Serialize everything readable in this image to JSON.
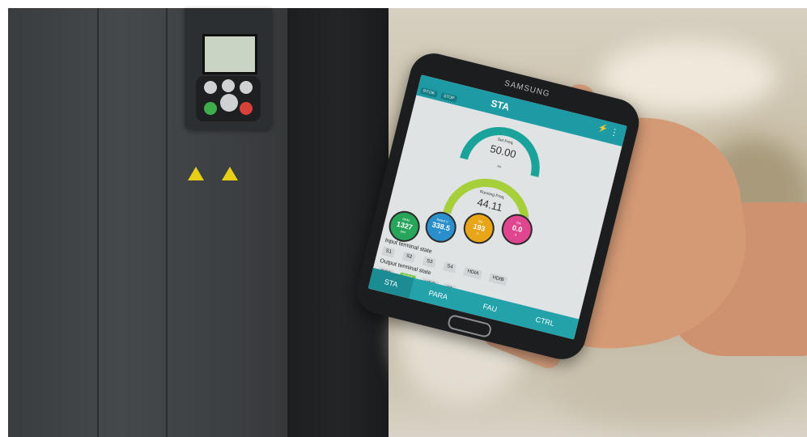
{
  "phone": {
    "brand": "SAMSUNG",
    "app_title": "STA",
    "status": [
      "RT:OK",
      "STOP"
    ],
    "gauges": [
      {
        "label": "Set Freq.",
        "value": "50.00",
        "unit": "Hz",
        "max": "50.00",
        "fill": 1.0,
        "color": "#1aa39b"
      },
      {
        "label": "Running Freq.",
        "value": "44.11",
        "unit": "Hz",
        "max": "50.00",
        "fill": 0.88,
        "color": "#a6cf3a"
      }
    ],
    "bubbles": [
      {
        "label": "RPM",
        "value": "1327",
        "unit": "rpm",
        "color": "#27a55b"
      },
      {
        "label": "Rated V",
        "value": "338.5",
        "unit": "V",
        "color": "#2a8fcb"
      },
      {
        "label": "OV",
        "value": "193",
        "unit": "V",
        "color": "#e7a517"
      },
      {
        "label": "OA",
        "value": "0.0",
        "unit": "A",
        "color": "#e0458f"
      }
    ],
    "input_title": "Input terminal state",
    "inputs": [
      "S1",
      "S2",
      "S3",
      "S4",
      "HDIA",
      "HDIB"
    ],
    "output_title": "Output terminal state",
    "outputs": [
      {
        "label": "RO2",
        "active": false
      },
      {
        "label": "RO1",
        "active": true
      },
      {
        "label": "HDO",
        "active": false
      },
      {
        "label": "Y1",
        "active": false
      }
    ],
    "tabs": [
      "STA",
      "PARA",
      "FAU",
      "CTRL"
    ],
    "active_tab": "STA"
  },
  "colors": {
    "app_bar": "#1d9aa3",
    "accent_green": "#7cc64b"
  }
}
